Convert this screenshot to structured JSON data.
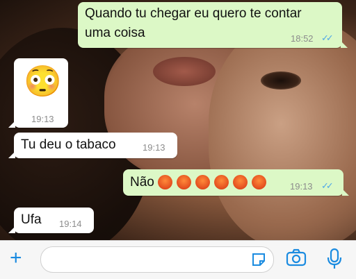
{
  "messages": [
    {
      "dir": "out",
      "text_line1": "Quando tu chegar eu quero te contar",
      "text_line2": "uma coisa",
      "time": "18:52",
      "status": "read"
    },
    {
      "dir": "in",
      "text": "😳",
      "time": "19:13"
    },
    {
      "dir": "in",
      "text": "Tu deu o tabaco",
      "time": "19:13"
    },
    {
      "dir": "out",
      "text": "Não",
      "emoji_count": 6,
      "time": "19:13",
      "status": "read"
    },
    {
      "dir": "in",
      "text": "Ufa",
      "time": "19:14"
    }
  ],
  "icons": {
    "attach": "plus-icon",
    "sticker": "sticker-icon",
    "camera": "camera-icon",
    "mic": "microphone-icon"
  },
  "colors": {
    "outgoing": "#dcf8c6",
    "incoming": "#ffffff",
    "accent": "#1a8be0",
    "read_ticks": "#4fa8e8"
  }
}
